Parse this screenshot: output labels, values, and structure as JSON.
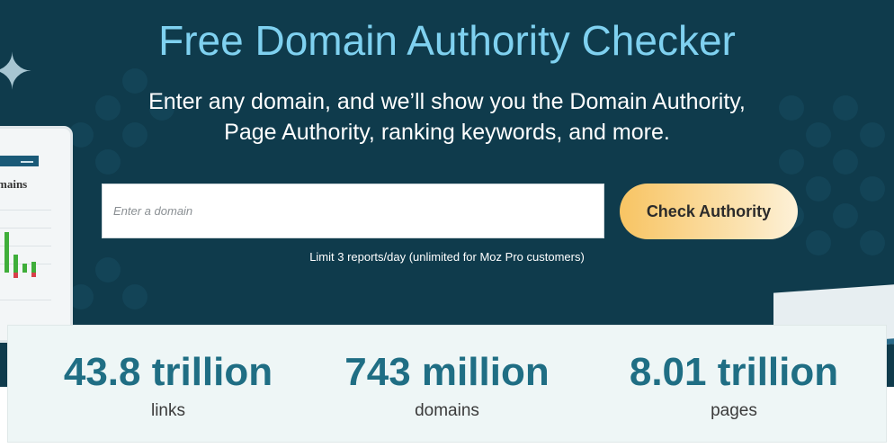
{
  "hero": {
    "title": "Free Domain Authority Checker",
    "subtitle_line1": "Enter any domain, and we’ll show you the Domain Authority,",
    "subtitle_line2": "Page Authority, ranking keywords, and more.",
    "background_color": "#0f3b4c",
    "title_color": "#7fd1f0"
  },
  "form": {
    "input_placeholder": "Enter a domain",
    "input_value": "",
    "button_label": "Check Authority",
    "limit_note": "Limit 3 reports/day (unlimited for Moz Pro customers)"
  },
  "illustration": {
    "left_panel_label": "mains",
    "sparkle_icon": "sparkle-icon"
  },
  "stats": [
    {
      "value": "43.8 trillion",
      "label": "links"
    },
    {
      "value": "743 million",
      "label": "domains"
    },
    {
      "value": "8.01 trillion",
      "label": "pages"
    }
  ]
}
